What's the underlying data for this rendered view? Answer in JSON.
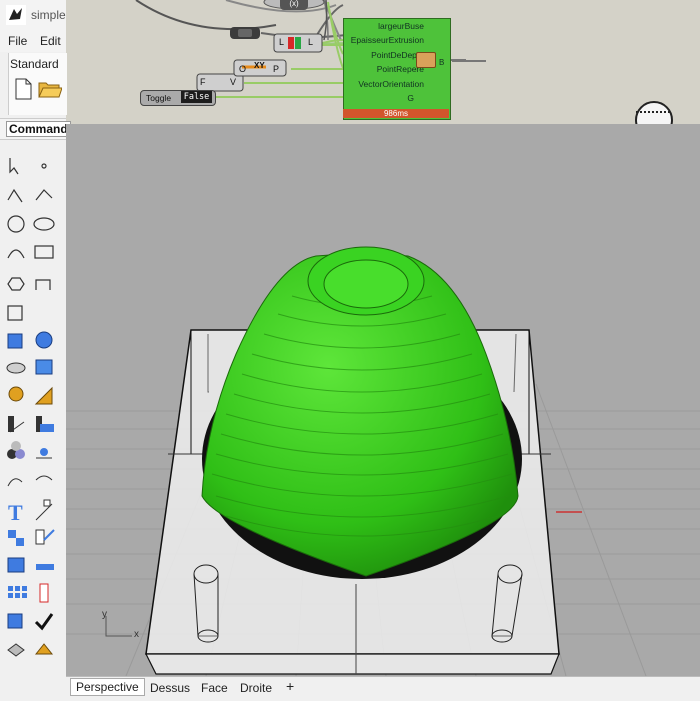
{
  "app": {
    "window_title": "simple",
    "menu": [
      {
        "label": "File"
      },
      {
        "label": "Edit"
      }
    ],
    "standard_label": "Standard",
    "command_label": "Command"
  },
  "grasshopper": {
    "component_inputs": [
      "largeurBuse",
      "EpaisseurExtrusion",
      "PointDeDepot",
      "PointRepere",
      "VectorOrientation",
      "G"
    ],
    "component_output": "B",
    "exec_time": "986ms",
    "toggle_label": "Toggle",
    "toggle_value": "False",
    "ports_small_1": [
      "F",
      "V"
    ],
    "ports_small_2": [
      "O",
      "P"
    ],
    "icon_label_xy": "XY",
    "ports_small_3": [
      "L",
      "L"
    ]
  },
  "viewport": {
    "tabs": [
      "Perspective",
      "Dessus",
      "Face",
      "Droite"
    ],
    "active_tab": "Perspective",
    "add_tab_icon": "plus-icon",
    "axis_labels": {
      "x": "x",
      "y": "y"
    },
    "dome_color": "#2fbf16",
    "box_color": "#f5f5f5"
  }
}
